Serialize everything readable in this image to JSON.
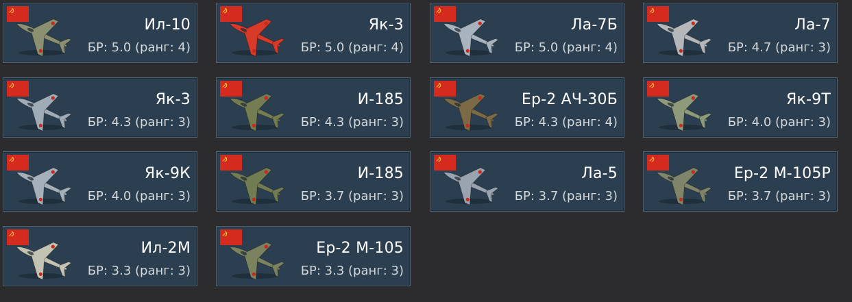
{
  "flag": {
    "name": "ussr-flag",
    "color": "#d52b1e"
  },
  "vehicles": [
    {
      "name": "Ил-10",
      "br": "БР: 5.0 (ранг: 4)",
      "tint": "#8a9070"
    },
    {
      "name": "Як-3",
      "br": "БР: 5.0 (ранг: 4)",
      "tint": "#d83a2a"
    },
    {
      "name": "Ла-7Б",
      "br": "БР: 5.0 (ранг: 4)",
      "tint": "#a9b3bd"
    },
    {
      "name": "Ла-7",
      "br": "БР: 4.7 (ранг: 3)",
      "tint": "#b5b7ba"
    },
    {
      "name": "Як-3",
      "br": "БР: 4.3 (ранг: 3)",
      "tint": "#9fabb6"
    },
    {
      "name": "И-185",
      "br": "БР: 4.3 (ранг: 3)",
      "tint": "#747d52"
    },
    {
      "name": "Ер-2 АЧ-30Б",
      "br": "БР: 4.3 (ранг: 4)",
      "tint": "#7b6a45"
    },
    {
      "name": "Як-9Т",
      "br": "БР: 4.0 (ранг: 3)",
      "tint": "#8f9a7a"
    },
    {
      "name": "Як-9К",
      "br": "БР: 4.0 (ранг: 3)",
      "tint": "#a5b0ba"
    },
    {
      "name": "И-185",
      "br": "БР: 3.7 (ранг: 3)",
      "tint": "#727c52"
    },
    {
      "name": "Ла-5",
      "br": "БР: 3.7 (ранг: 3)",
      "tint": "#9aa4b0"
    },
    {
      "name": "Ер-2 М-105Р",
      "br": "БР: 3.7 (ранг: 3)",
      "tint": "#808468"
    },
    {
      "name": "Ил-2М",
      "br": "БР: 3.3 (ранг: 3)",
      "tint": "#c4c2b2"
    },
    {
      "name": "Ер-2 М-105",
      "br": "БР: 3.3 (ранг: 3)",
      "tint": "#7a8260"
    }
  ]
}
